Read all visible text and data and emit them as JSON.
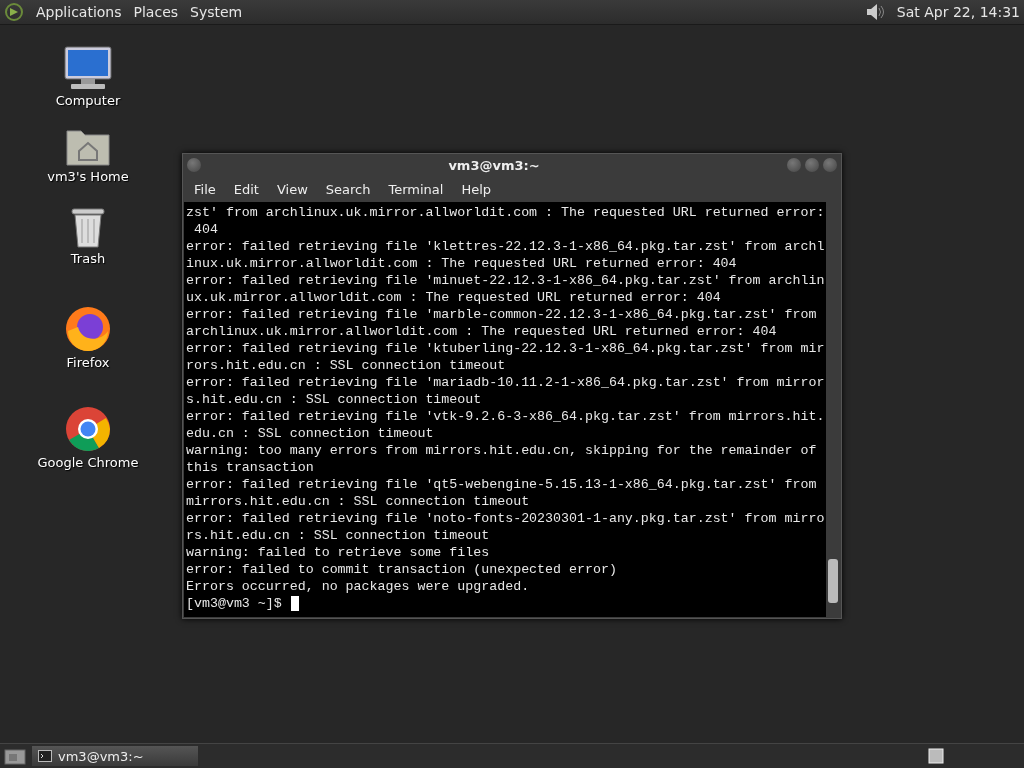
{
  "top_panel": {
    "menus": [
      "Applications",
      "Places",
      "System"
    ],
    "clock": "Sat Apr 22, 14:31"
  },
  "desktop_icons": [
    {
      "kind": "computer",
      "label": "Computer"
    },
    {
      "kind": "home",
      "label": "vm3's Home"
    },
    {
      "kind": "trash",
      "label": "Trash"
    },
    {
      "kind": "firefox",
      "label": "Firefox"
    },
    {
      "kind": "chrome",
      "label": "Google Chrome"
    }
  ],
  "terminal": {
    "title": "vm3@vm3:~",
    "menu": [
      "File",
      "Edit",
      "View",
      "Search",
      "Terminal",
      "Help"
    ],
    "lines": [
      "zst' from archlinux.uk.mirror.allworldit.com : The requested URL returned error:",
      " 404",
      "error: failed retrieving file 'klettres-22.12.3-1-x86_64.pkg.tar.zst' from archl",
      "inux.uk.mirror.allworldit.com : The requested URL returned error: 404",
      "error: failed retrieving file 'minuet-22.12.3-1-x86_64.pkg.tar.zst' from archlin",
      "ux.uk.mirror.allworldit.com : The requested URL returned error: 404",
      "error: failed retrieving file 'marble-common-22.12.3-1-x86_64.pkg.tar.zst' from",
      "archlinux.uk.mirror.allworldit.com : The requested URL returned error: 404",
      "error: failed retrieving file 'ktuberling-22.12.3-1-x86_64.pkg.tar.zst' from mir",
      "rors.hit.edu.cn : SSL connection timeout",
      "error: failed retrieving file 'mariadb-10.11.2-1-x86_64.pkg.tar.zst' from mirror",
      "s.hit.edu.cn : SSL connection timeout",
      "error: failed retrieving file 'vtk-9.2.6-3-x86_64.pkg.tar.zst' from mirrors.hit.",
      "edu.cn : SSL connection timeout",
      "warning: too many errors from mirrors.hit.edu.cn, skipping for the remainder of",
      "this transaction",
      "error: failed retrieving file 'qt5-webengine-5.15.13-1-x86_64.pkg.tar.zst' from",
      "mirrors.hit.edu.cn : SSL connection timeout",
      "error: failed retrieving file 'noto-fonts-20230301-1-any.pkg.tar.zst' from mirro",
      "rs.hit.edu.cn : SSL connection timeout",
      "warning: failed to retrieve some files",
      "error: failed to commit transaction (unexpected error)",
      "Errors occurred, no packages were upgraded."
    ],
    "prompt": "[vm3@vm3 ~]$"
  },
  "taskbar": {
    "tasks": [
      {
        "label": "vm3@vm3:~",
        "selected": true
      }
    ]
  }
}
